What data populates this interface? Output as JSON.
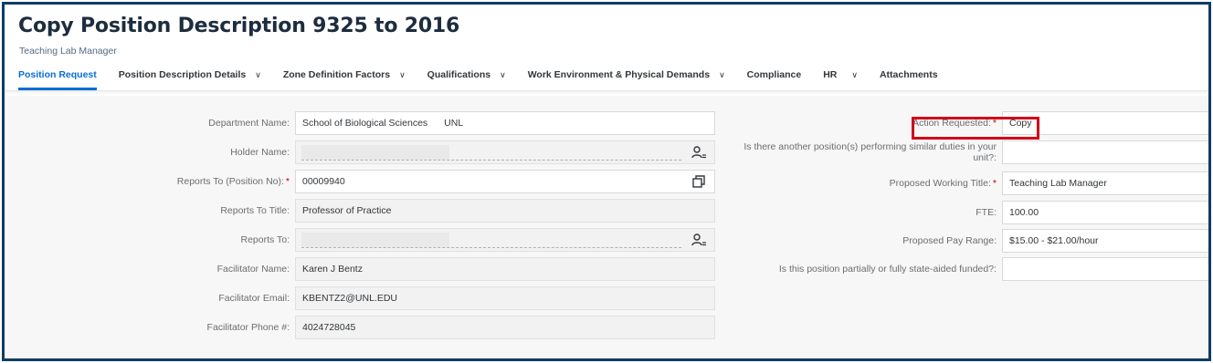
{
  "page": {
    "title": "Copy Position Description 9325 to 2016",
    "subtitle": "Teaching Lab Manager"
  },
  "tabs": [
    {
      "label": "Position Request",
      "active": true,
      "dropdown": false
    },
    {
      "label": "Position Description Details",
      "dropdown": true
    },
    {
      "label": "Zone Definition Factors",
      "dropdown": true
    },
    {
      "label": "Qualifications",
      "dropdown": true
    },
    {
      "label": "Work Environment & Physical Demands",
      "dropdown": true
    },
    {
      "label": "Compliance",
      "dropdown": false
    },
    {
      "label": "HR",
      "dropdown": true
    },
    {
      "label": "Attachments",
      "dropdown": false
    }
  ],
  "left_form": {
    "department_name": {
      "label": "Department Name:",
      "value": "School of Biological Sciences",
      "suffix": "UNL"
    },
    "holder_name": {
      "label": "Holder Name:",
      "value": ""
    },
    "reports_to_position": {
      "label": "Reports To (Position No):",
      "required": true,
      "value": "00009940"
    },
    "reports_to_title": {
      "label": "Reports To Title:",
      "value": "Professor of Practice"
    },
    "reports_to": {
      "label": "Reports To:",
      "value": ""
    },
    "facilitator_name": {
      "label": "Facilitator Name:",
      "value": "Karen J Bentz"
    },
    "facilitator_email": {
      "label": "Facilitator Email:",
      "value": "KBENTZ2@UNL.EDU"
    },
    "facilitator_phone": {
      "label": "Facilitator Phone #:",
      "value": "4024728045"
    }
  },
  "right_form": {
    "action_requested": {
      "label": "Action Requested:",
      "required": true,
      "value": "Copy"
    },
    "similar_positions": {
      "label": "Is there another position(s) performing similar duties in your unit?:",
      "value": ""
    },
    "proposed_title": {
      "label": "Proposed Working Title:",
      "required": true,
      "value": "Teaching Lab Manager"
    },
    "fte": {
      "label": "FTE:",
      "value": "100.00"
    },
    "pay_range": {
      "label": "Proposed Pay Range:",
      "value": "$15.00 - $21.00/hour"
    },
    "state_aided": {
      "label": "Is this position partially or fully state-aided funded?:",
      "value": ""
    }
  },
  "required_marker": "*",
  "icons": {
    "person_picker": "person-picker-icon",
    "open_window": "open-in-window-icon",
    "dropdown": "chevron-down-icon"
  },
  "colors": {
    "frame": "#0f3d64",
    "accent": "#0a6ed1",
    "highlight": "#d0021b",
    "required": "#bb0000"
  }
}
